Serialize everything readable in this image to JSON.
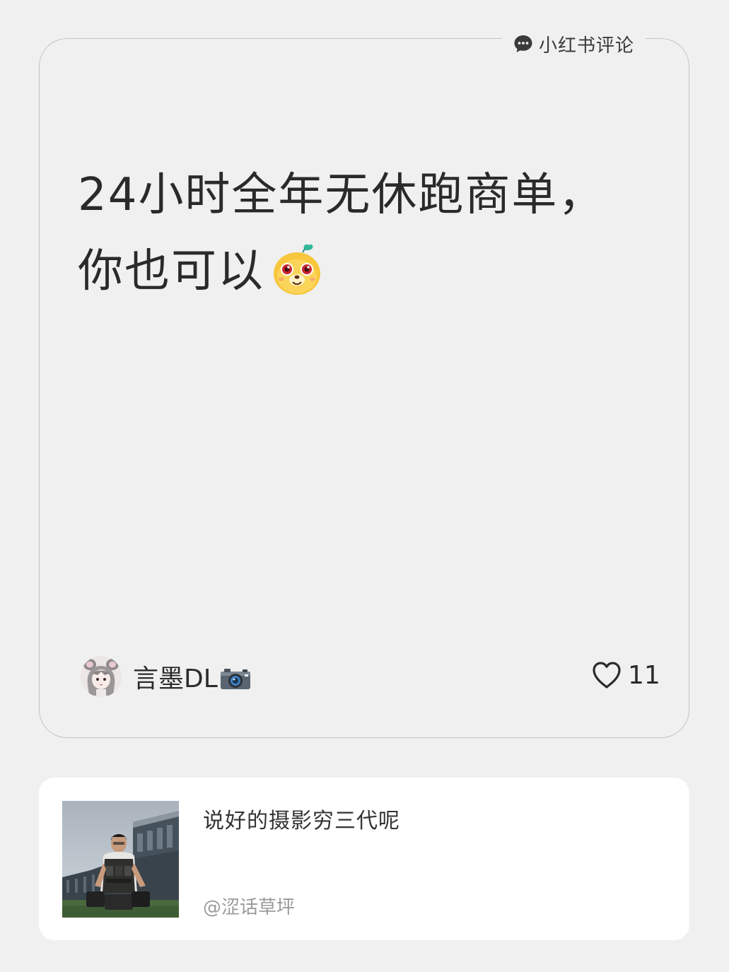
{
  "header": {
    "source_label": "小红书评论",
    "source_icon": "chat-bubble-icon"
  },
  "comment": {
    "line1": "24小时全年无休跑商单，",
    "line2": "你也可以",
    "emoji": "yellow-dog-sticker-icon"
  },
  "author": {
    "name": "言墨DL",
    "name_emoji": "camera-icon",
    "avatar": "anime-girl-avatar"
  },
  "likes": {
    "count": "11",
    "icon": "heart-outline-icon"
  },
  "post": {
    "title": "说好的摄影穷三代呢",
    "author": "@涩话草坪",
    "thumbnail": "photographer-with-gear-photo"
  },
  "colors": {
    "background": "#f0f0f0",
    "card_border": "#c4c4c4",
    "text": "#2b2b2b",
    "muted": "#9a9a9a"
  }
}
